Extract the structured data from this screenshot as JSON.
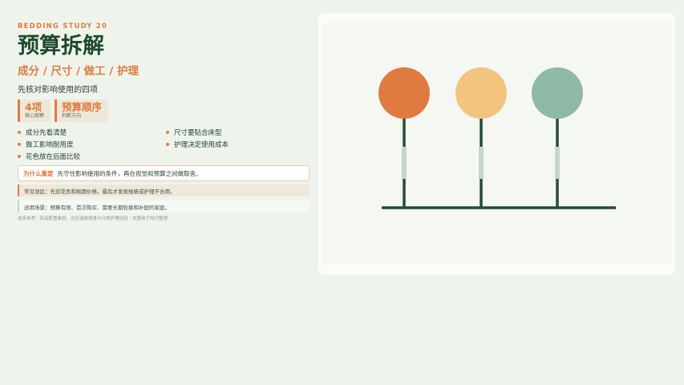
{
  "header": {
    "eyebrow": "BEDDING STUDY 20",
    "title": "预算拆解",
    "subtitle": "成分 / 尺寸 / 做工 / 护理",
    "lead": "先核对影响使用的四项"
  },
  "stats": [
    {
      "value": "4项",
      "label": "核心观察"
    },
    {
      "value": "预算顺序",
      "label": "判断方向"
    }
  ],
  "bullets": [
    "成分先看清楚",
    "尺寸要贴合床型",
    "做工影响耐用度",
    "护理决定使用成本",
    "花色放在后面比较"
  ],
  "why": {
    "label": "为什么重要",
    "text": "先守住影响使用的条件，再在视觉和预算之间做取舍。"
  },
  "mistake": "常见误区：先追花色和抛期价格，最后才发现规格或护理不合用。",
  "scene": "适用场景：预算有限、首次购买、需要长期轮换和补配的家庭。",
  "footnote": "信息参考：床品配置素材、对应选购场景与日常护理经验｜本图用于知识整理",
  "illustration": {
    "colors": {
      "orange": "#e07b3f",
      "yellow": "#f2c47e",
      "green": "#8fb8a5",
      "stem": "#244d33",
      "band": "#c6d6cf"
    },
    "circles": [
      "orange",
      "yellow",
      "green"
    ]
  }
}
